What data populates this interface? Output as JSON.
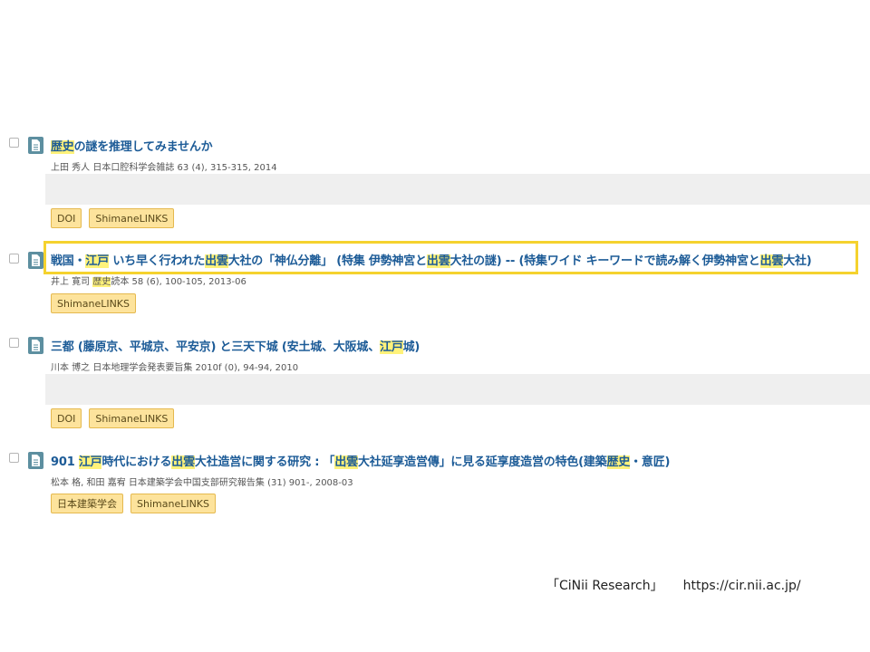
{
  "results": [
    {
      "title_parts": [
        {
          "text": "歴史",
          "hl": true
        },
        {
          "text": "の謎を推理してみませんか",
          "hl": false
        }
      ],
      "meta_parts": [
        {
          "text": "上田 秀人 日本口腔科学会雑誌 63 (4), 315-315, 2014",
          "hl": false
        }
      ],
      "has_gray_box": true,
      "links": [
        "DOI",
        "ShimaneLINKS"
      ]
    },
    {
      "title_parts": [
        {
          "text": "戦国・",
          "hl": false
        },
        {
          "text": "江戸",
          "hl": true
        },
        {
          "text": " いち早く行われた",
          "hl": false
        },
        {
          "text": "出雲",
          "hl": true
        },
        {
          "text": "大社の「神仏分離」 (特集 伊勢神宮と",
          "hl": false
        },
        {
          "text": "出雲",
          "hl": true
        },
        {
          "text": "大社の謎) -- (特集ワイド キーワードで読み解く伊勢神宮と",
          "hl": false
        },
        {
          "text": "出雲",
          "hl": true
        },
        {
          "text": "大社)",
          "hl": false
        }
      ],
      "meta_parts": [
        {
          "text": "井上 寛司 ",
          "hl": false
        },
        {
          "text": "歴史",
          "hl": true
        },
        {
          "text": "読本 58 (6), 100-105, 2013-06",
          "hl": false
        }
      ],
      "has_gray_box": false,
      "links": [
        "ShimaneLINKS"
      ]
    },
    {
      "title_parts": [
        {
          "text": "三都 (藤原京、平城京、平安京) と三天下城 (安土城、大阪城、",
          "hl": false
        },
        {
          "text": "江戸",
          "hl": true
        },
        {
          "text": "城)",
          "hl": false
        }
      ],
      "meta_parts": [
        {
          "text": "川本 博之 日本地理学会発表要旨集 2010f (0), 94-94, 2010",
          "hl": false
        }
      ],
      "has_gray_box": true,
      "links": [
        "DOI",
        "ShimaneLINKS"
      ]
    },
    {
      "title_parts": [
        {
          "text": "901 ",
          "hl": false
        },
        {
          "text": "江戸",
          "hl": true
        },
        {
          "text": "時代における",
          "hl": false
        },
        {
          "text": "出雲",
          "hl": true
        },
        {
          "text": "大社造営に関する研究 : 「",
          "hl": false
        },
        {
          "text": "出雲",
          "hl": true
        },
        {
          "text": "大社延享造営傳」に見る延享度造営の特色(建築",
          "hl": false
        },
        {
          "text": "歴史",
          "hl": true
        },
        {
          "text": "・意匠)",
          "hl": false
        }
      ],
      "meta_parts": [
        {
          "text": "松本 格, 和田 嘉宥 日本建築学会中国支部研究報告集 (31) 901-, 2008-03",
          "hl": false
        }
      ],
      "has_gray_box": false,
      "links": [
        "日本建築学会",
        "ShimaneLINKS"
      ]
    }
  ],
  "credit": {
    "source": "「CiNii Research」",
    "url": "https://cir.nii.ac.jp/"
  },
  "icons": {
    "checkbox": "checkbox-icon",
    "document": "document-icon"
  },
  "colors": {
    "title": "#1c5b97",
    "highlight": "#fff27a",
    "badge_bg": "#fde39c",
    "badge_border": "#e5b94f",
    "frame": "#f5d22e",
    "doc_icon": "#5d8fa0"
  }
}
